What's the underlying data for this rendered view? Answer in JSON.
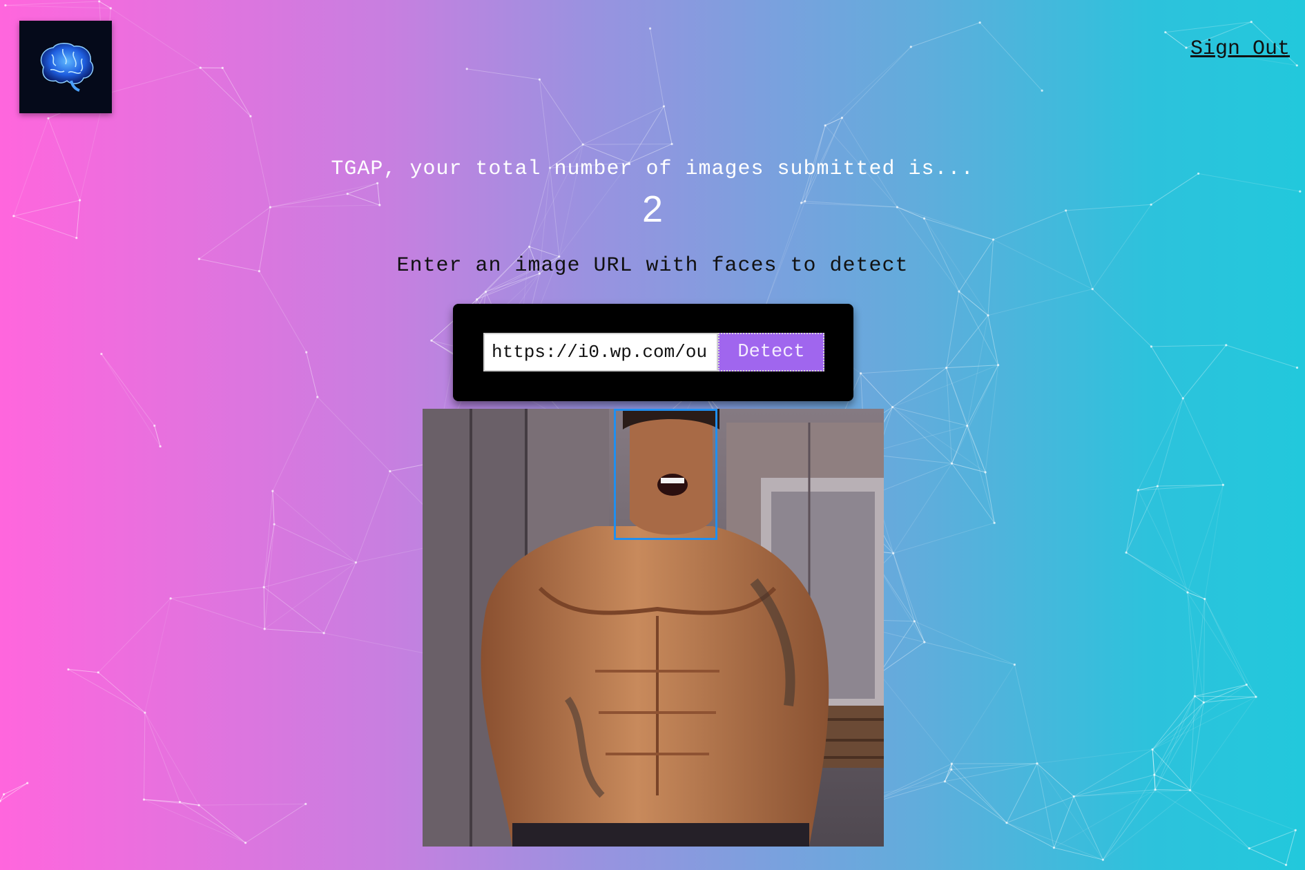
{
  "header": {
    "logo_icon": "brain-icon",
    "signout_label": "Sign Out"
  },
  "rank": {
    "message": "TGAP, your total number of images submitted is...",
    "count": "2"
  },
  "form": {
    "prompt": "Enter an image URL with faces to detect",
    "url_value": "https://i0.wp.com/ou",
    "detect_label": "Detect"
  },
  "result": {
    "face_box_count": 1
  },
  "colors": {
    "gradient_left": "#ff66dd",
    "gradient_right": "#22c8dc",
    "button": "#a066ee",
    "face_box": "#1f8ff0"
  }
}
